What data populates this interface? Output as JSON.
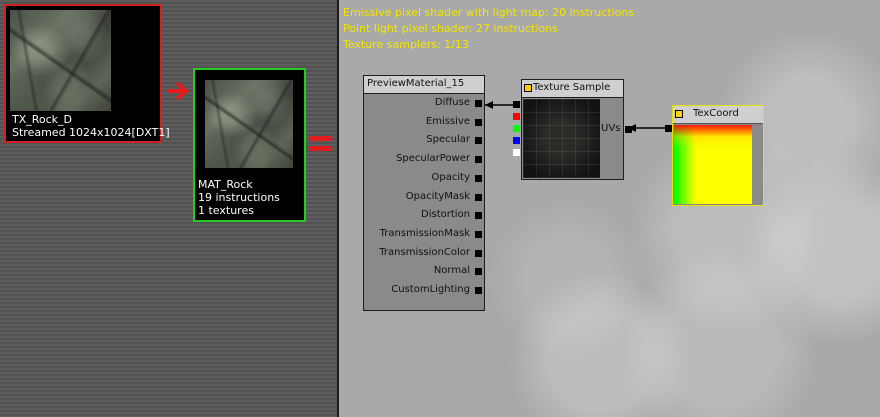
{
  "texture_thumb": {
    "name": "TX_Rock_D",
    "info": "Streamed 1024x1024[DXT1]"
  },
  "material_thumb": {
    "name": "MAT_Rock",
    "instructions": "19 instructions",
    "textures": "1 textures"
  },
  "stats": [
    "Emissive pixel shader with light map: 20 instructions",
    "Point light pixel shader: 27 instructions",
    "Texture samplers: 1/13"
  ],
  "material_node": {
    "title": "PreviewMaterial_15",
    "inputs": [
      "Diffuse",
      "Emissive",
      "Specular",
      "SpecularPower",
      "Opacity",
      "OpacityMask",
      "Distortion",
      "TransmissionMask",
      "TransmissionColor",
      "Normal",
      "CustomLighting"
    ]
  },
  "texture_sample_node": {
    "title": "Texture Sample",
    "input": "UVs",
    "channel_colors": [
      "#ff0000",
      "#00ff00",
      "#0000ff",
      "#ffffff"
    ]
  },
  "texcoord_node": {
    "title": "TexCoord"
  },
  "colors": {
    "texture_border": "#d21f1f",
    "material_border": "#22cc22",
    "arrow": "#e21c1c",
    "stats_text": "#f2e600",
    "node_title_bg": "#cfcfcf",
    "node_body_bg": "#8a8a8a"
  },
  "icons": [
    "right-arrow-icon",
    "equals-icon",
    "texture-sample-swatch-icon",
    "texcoord-swatch-icon"
  ]
}
